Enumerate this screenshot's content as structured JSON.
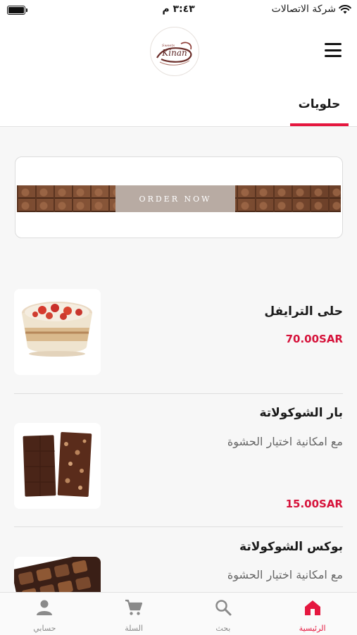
{
  "status_bar": {
    "carrier": "شركة الاتصالات",
    "time": "٣:٤٣ م"
  },
  "header": {
    "logo_text": "Kinan",
    "logo_subtext": "Sweets"
  },
  "tabs": [
    {
      "label": "حلويات",
      "active": true
    }
  ],
  "banner": {
    "label": "ORDER NOW"
  },
  "products": [
    {
      "name": "حلى الترايفل",
      "description": "",
      "price": "70.00SAR"
    },
    {
      "name": "بار الشوكولاتة",
      "description": "مع امكانية اختيار الحشوة",
      "price": "15.00SAR"
    },
    {
      "name": "بوكس الشوكولاتة",
      "description": "مع امكانية اختيار الحشوة",
      "price": ""
    }
  ],
  "bottom_nav": [
    {
      "label": "الرئيسية",
      "icon": "home-icon",
      "active": true
    },
    {
      "label": "بحث",
      "icon": "search-icon",
      "active": false
    },
    {
      "label": "السلة",
      "icon": "cart-icon",
      "active": false
    },
    {
      "label": "حسابي",
      "icon": "account-icon",
      "active": false
    }
  ],
  "colors": {
    "accent": "#e5173f",
    "price": "#d6133b",
    "inactive_nav": "#8a8a8a"
  }
}
